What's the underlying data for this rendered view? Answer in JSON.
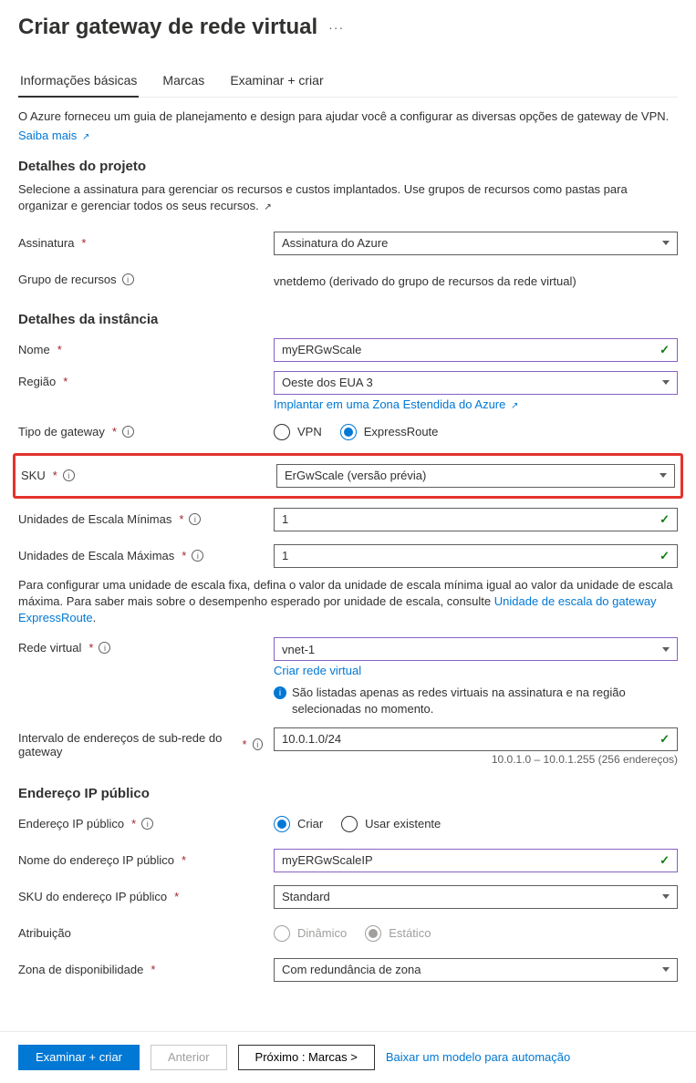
{
  "pageTitle": "Criar gateway de rede virtual",
  "tabs": {
    "basics": "Informações básicas",
    "tags": "Marcas",
    "review": "Examinar + criar"
  },
  "intro": {
    "text": "O Azure forneceu um guia de planejamento e design para ajudar você a configurar as diversas opções de gateway de VPN.",
    "learnMore": "Saiba mais"
  },
  "projectDetails": {
    "header": "Detalhes do projeto",
    "desc": "Selecione a assinatura para gerenciar os recursos e custos implantados. Use grupos de recursos como pastas para organizar e gerenciar todos os seus recursos.",
    "subscriptionLabel": "Assinatura",
    "subscriptionValue": "Assinatura do Azure",
    "rgLabel": "Grupo de recursos",
    "rgValue": "vnetdemo (derivado do grupo de recursos da rede virtual)"
  },
  "instanceDetails": {
    "header": "Detalhes da instância",
    "nameLabel": "Nome",
    "nameValue": "myERGwScale",
    "regionLabel": "Região",
    "regionValue": "Oeste dos EUA 3",
    "azExtendedLink": "Implantar em uma Zona Estendida do Azure",
    "gatewayTypeLabel": "Tipo de gateway",
    "gatewayTypeVpn": "VPN",
    "gatewayTypeER": "ExpressRoute",
    "skuLabel": "SKU",
    "skuValue": "ErGwScale (versão prévia)",
    "minScaleLabel": "Unidades de Escala Mínimas",
    "minScaleValue": "1",
    "maxScaleLabel": "Unidades de Escala Máximas",
    "maxScaleValue": "1",
    "scaleNotePrefix": "Para configurar uma unidade de escala fixa, defina o valor da unidade de escala mínima igual ao valor da unidade de escala máxima. Para saber mais sobre o desempenho esperado por unidade de escala, consulte ",
    "scaleNoteLink": "Unidade de escala do gateway ExpressRoute",
    "vnetLabel": "Rede virtual",
    "vnetValue": "vnet-1",
    "createVnetLink": "Criar rede virtual",
    "vnetInfo": "São listadas apenas as redes virtuais na assinatura e na região selecionadas no momento.",
    "subnetLabel": "Intervalo de endereços de sub-rede do gateway",
    "subnetValue": "10.0.1.0/24",
    "subnetHint": "10.0.1.0 – 10.0.1.255 (256 endereços)"
  },
  "publicIp": {
    "header": "Endereço IP público",
    "pipLabel": "Endereço IP público",
    "createNew": "Criar",
    "useExisting": "Usar existente",
    "pipNameLabel": "Nome do endereço IP público",
    "pipNameValue": "myERGwScaleIP",
    "pipSkuLabel": "SKU do endereço IP público",
    "pipSkuValue": "Standard",
    "assignLabel": "Atribuição",
    "assignDynamic": "Dinâmico",
    "assignStatic": "Estático",
    "azLabel": "Zona de disponibilidade",
    "azValue": "Com redundância de zona"
  },
  "footer": {
    "review": "Examinar + criar",
    "previous": "Anterior",
    "next": "Próximo : Marcas >",
    "download": "Baixar um modelo para automação"
  }
}
